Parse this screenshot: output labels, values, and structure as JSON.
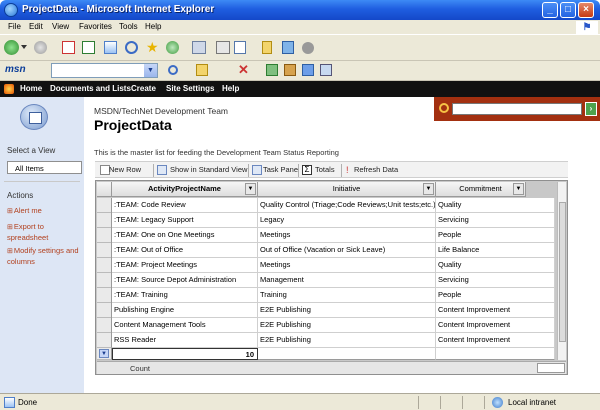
{
  "window": {
    "title": "ProjectData - Microsoft Internet Explorer",
    "minimize": "_",
    "maximize": "□",
    "close": "×"
  },
  "menu": [
    "File",
    "Edit",
    "View",
    "Favorites",
    "Tools",
    "Help"
  ],
  "toolbar": {
    "msn_label": "msn"
  },
  "spnav": [
    "Home",
    "Documents and Lists",
    "Create",
    "Site Settings",
    "Help"
  ],
  "header": {
    "site_name": "MSDN/TechNet Development Team",
    "page_title": "ProjectData",
    "search_go": "›"
  },
  "leftnav": {
    "select_view": "Select a View",
    "view_item": "All Items",
    "actions": "Actions",
    "action_items": [
      "Alert me",
      "Export to spreadsheet",
      "Modify settings and columns"
    ]
  },
  "description": "This is the master list for feeding the Development Team Status Reporting",
  "list_toolbar": [
    "New Row",
    "Show in Standard View",
    "Task Pane",
    "Totals",
    "Refresh Data"
  ],
  "grid": {
    "columns": [
      "ActivityProjectName",
      "Initiative",
      "Commitment"
    ],
    "rows": [
      [
        ":TEAM: Code Review",
        "Quality Control (Triage;Code Reviews;Unit tests;etc.)",
        "Quality"
      ],
      [
        ":TEAM: Legacy Support",
        "Legacy",
        "Servicing"
      ],
      [
        ":TEAM: One on One Meetings",
        "Meetings",
        "People"
      ],
      [
        ":TEAM: Out of Office",
        "Out of Office (Vacation or Sick Leave)",
        "Life Balance"
      ],
      [
        ":TEAM: Project Meetings",
        "Meetings",
        "Quality"
      ],
      [
        ":TEAM: Source Depot Administration",
        "Management",
        "Servicing"
      ],
      [
        ":TEAM: Training",
        "Training",
        "People"
      ],
      [
        "Publishing Engine",
        "E2E Publishing",
        "Content Improvement"
      ],
      [
        "Content Management Tools",
        "E2E Publishing",
        "Content Improvement"
      ],
      [
        "RSS Reader",
        "E2E Publishing",
        "Content Improvement"
      ]
    ],
    "total_value": "10",
    "count_label": "Count"
  },
  "status": {
    "left": "Done",
    "zone": "Local intranet"
  }
}
